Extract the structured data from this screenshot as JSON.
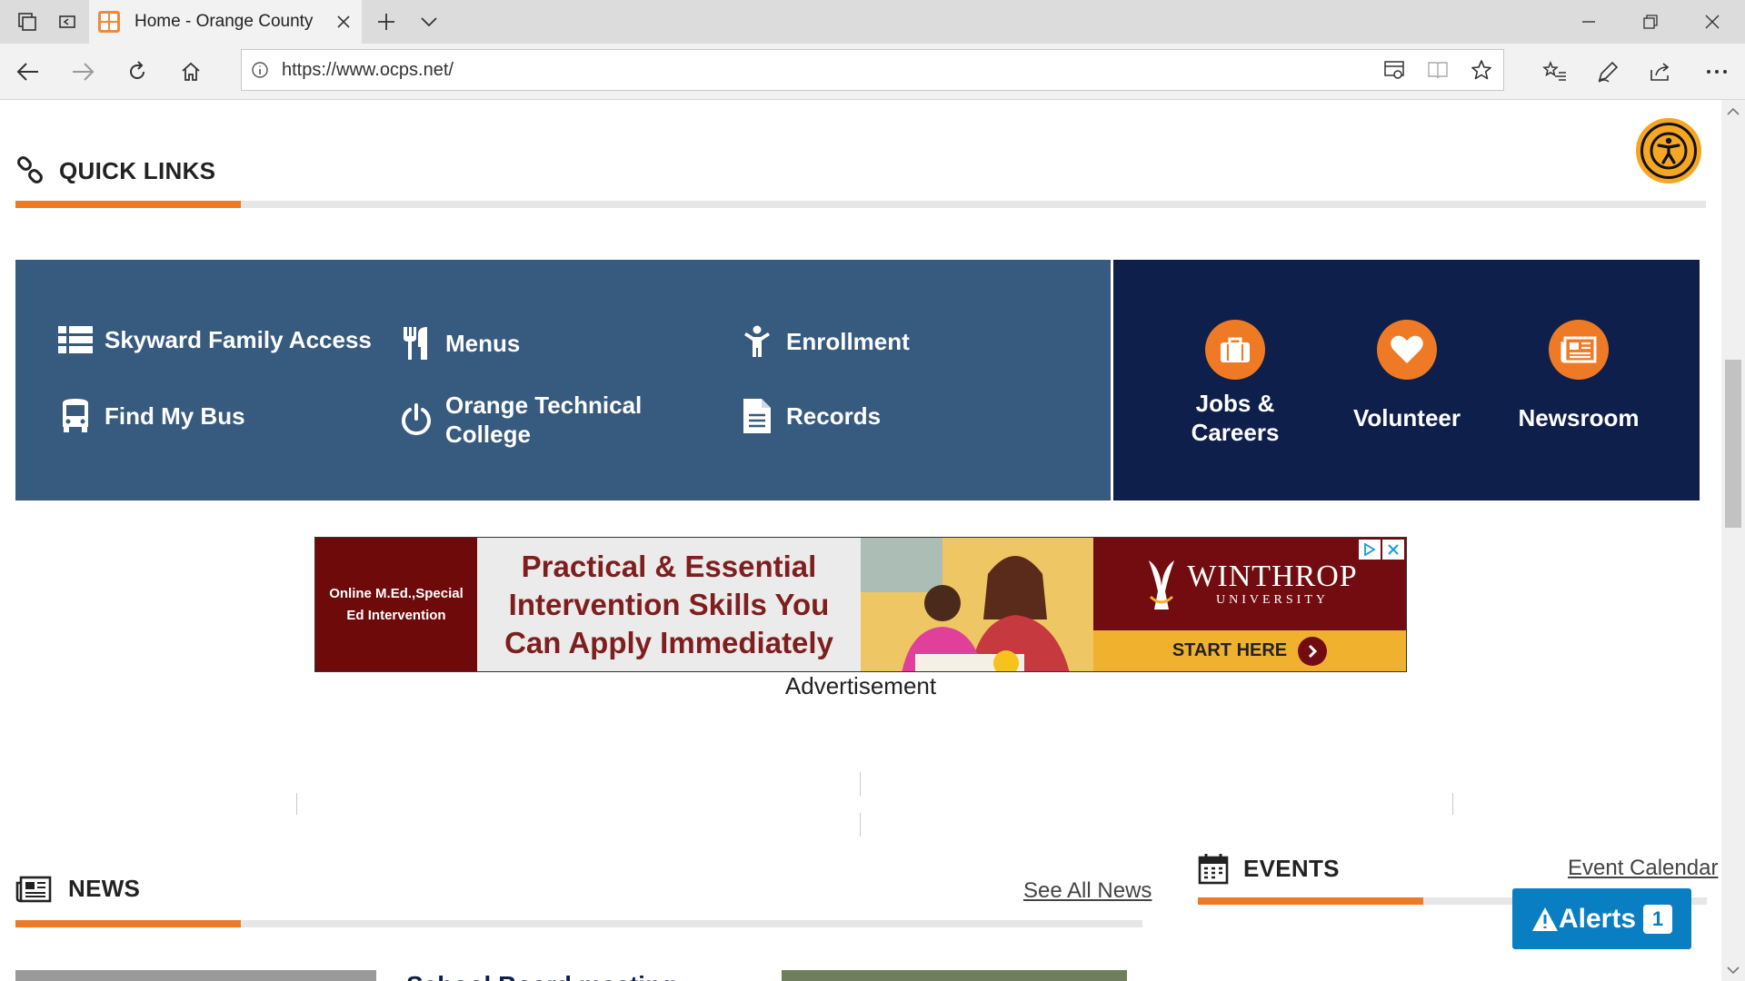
{
  "browser": {
    "tab_title": "Home - Orange County",
    "url": "https://www.ocps.net/"
  },
  "quick_links": {
    "title": "QUICK LINKS",
    "left": [
      {
        "label": "Skyward Family Access",
        "icon": "list-icon"
      },
      {
        "label": "Menus",
        "icon": "utensils-icon"
      },
      {
        "label": "Enrollment",
        "icon": "child-icon"
      },
      {
        "label": "Find My Bus",
        "icon": "bus-icon"
      },
      {
        "label": "Orange Technical College",
        "icon": "power-icon"
      },
      {
        "label": "Records",
        "icon": "document-icon"
      }
    ],
    "right": [
      {
        "label": "Jobs & Careers",
        "icon": "briefcase-icon"
      },
      {
        "label": "Volunteer",
        "icon": "heart-icon"
      },
      {
        "label": "Newsroom",
        "icon": "newspaper-icon"
      }
    ]
  },
  "ad": {
    "left_text": "Online M.Ed.,Special Ed Intervention",
    "headline": "Practical & Essential Intervention Skills You Can Apply Immediately",
    "brand": "WINTHROP",
    "brand_sub": "UNIVERSITY",
    "cta": "START HERE",
    "label": "Advertisement"
  },
  "news": {
    "title": "NEWS",
    "see_all": "See All News",
    "first_title_peek": "School Board meeting"
  },
  "events": {
    "title": "EVENTS",
    "calendar_link": "Event Calendar"
  },
  "alerts": {
    "label": "Alerts",
    "count": "1"
  },
  "colors": {
    "accent": "#ef7a26",
    "ql_left_bg": "#375a7f",
    "ql_right_bg": "#0d1f4a",
    "alerts_bg": "#0a7ec2"
  }
}
